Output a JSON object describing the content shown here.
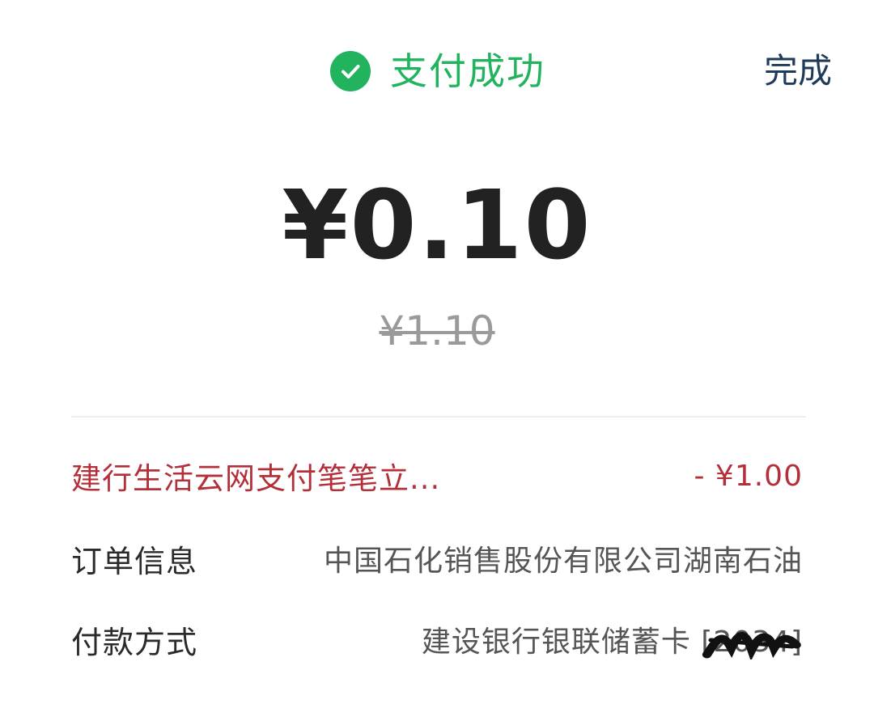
{
  "header": {
    "status_text": "支付成功",
    "done_label": "完成",
    "status_color": "#22b35e"
  },
  "payment": {
    "amount": "¥0.10",
    "original_amount": "¥1.10"
  },
  "discount": {
    "label": "建行生活云网支付笔笔立...",
    "value": "- ¥1.00",
    "color": "#b3303a"
  },
  "order_info": {
    "label": "订单信息",
    "value": "中国石化销售股份有限公司湖南石油"
  },
  "payment_method": {
    "label": "付款方式",
    "bank": "建设银行银联储蓄卡",
    "card_number": "[2034]"
  },
  "icons": {
    "status": "check-circle-icon",
    "masking": "redaction-scribble"
  }
}
